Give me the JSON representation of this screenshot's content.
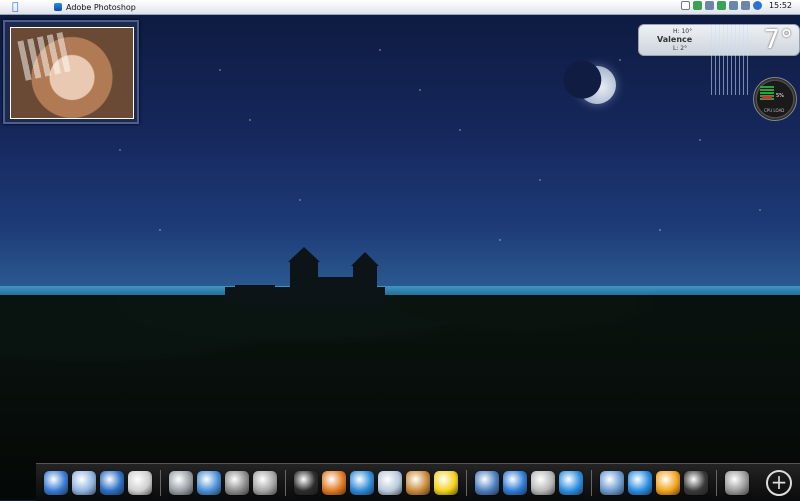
{
  "menubar": {
    "app_name": "Adobe Photoshop",
    "clock": "15:52"
  },
  "weather": {
    "high": "H: 10°",
    "city": "Valence",
    "low": "L: 2°",
    "temperature": "7°"
  },
  "cpu_gauge": {
    "percent": "5%",
    "label": "CPU LOAD"
  },
  "colors": {
    "sky_top": "#0d1a3e",
    "horizon": "#4aa2c8",
    "dock_bg": "#141414"
  },
  "dock": {
    "items": [
      {
        "name": "finder-icon",
        "color": "#3a7bd5"
      },
      {
        "name": "desktop-icon",
        "color": "#8fb4e0"
      },
      {
        "name": "globe-icon",
        "color": "#2b6fc4"
      },
      {
        "name": "apple-icon",
        "color": "#cfcfcf"
      },
      {
        "name": "drive-icon",
        "color": "#9aa0a6"
      },
      {
        "name": "scanner-icon",
        "color": "#4a8fd6"
      },
      {
        "name": "disk-icon",
        "color": "#8c8c8c"
      },
      {
        "name": "disk2-icon",
        "color": "#a5a5a5"
      },
      {
        "name": "speaker-icon",
        "color": "#2c2c2c"
      },
      {
        "name": "firefox-icon",
        "color": "#e07a22"
      },
      {
        "name": "feather-icon",
        "color": "#2e8bd8"
      },
      {
        "name": "waveform-icon",
        "color": "#b9c9dc"
      },
      {
        "name": "photos-icon",
        "color": "#c98b3b"
      },
      {
        "name": "radiation-icon",
        "color": "#f3d21b"
      },
      {
        "name": "mail-icon",
        "color": "#4b7fbf"
      },
      {
        "name": "ie-icon",
        "color": "#2f7cd6"
      },
      {
        "name": "podcast-icon",
        "color": "#b8b8b8"
      },
      {
        "name": "chat-icon",
        "color": "#2d8ee0"
      },
      {
        "name": "itunes-icon",
        "color": "#6c9bd0"
      },
      {
        "name": "quicktime-icon",
        "color": "#2a8de0"
      },
      {
        "name": "play-icon",
        "color": "#f2a31b"
      },
      {
        "name": "film-icon",
        "color": "#3a3a3a"
      },
      {
        "name": "trash-icon",
        "color": "#9a9a9a"
      }
    ]
  }
}
